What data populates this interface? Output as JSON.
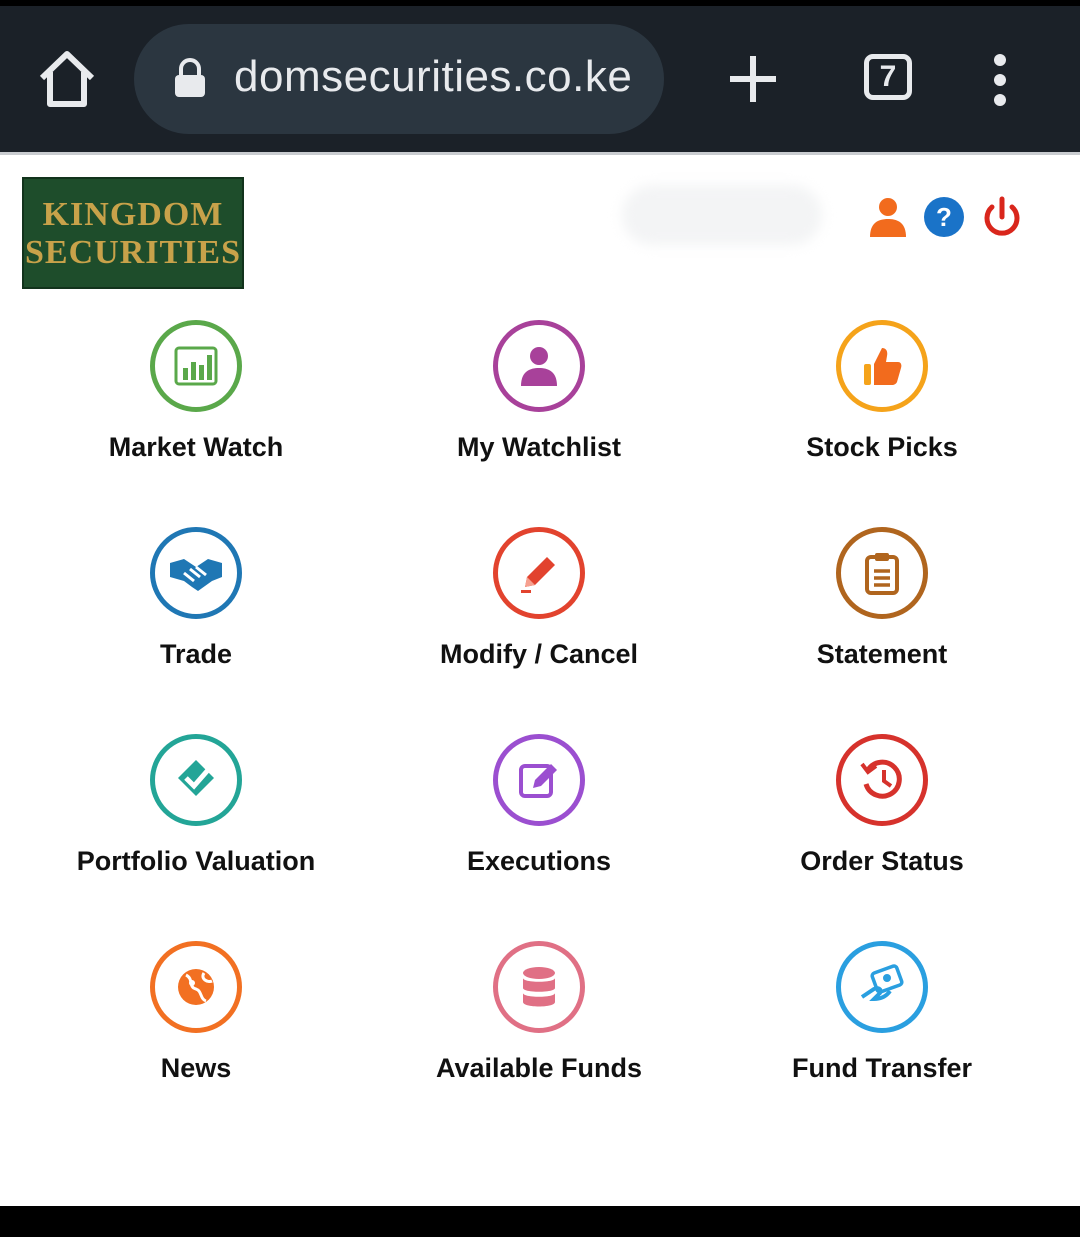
{
  "browser": {
    "url": "domsecurities.co.ke",
    "tab_count": "7"
  },
  "header": {
    "logo_line1": "KINGDOM",
    "logo_line2": "SECURITIES"
  },
  "menu": [
    {
      "label": "Market Watch",
      "icon": "bar-chart-icon",
      "color": "#5aa84a"
    },
    {
      "label": "My Watchlist",
      "icon": "person-icon",
      "color": "#a8419a"
    },
    {
      "label": "Stock Picks",
      "icon": "thumbs-up-icon",
      "color": "#f5a31a"
    },
    {
      "label": "Trade",
      "icon": "handshake-icon",
      "color": "#1f77b4"
    },
    {
      "label": "Modify / Cancel",
      "icon": "pencil-icon",
      "color": "#e2432e"
    },
    {
      "label": "Statement",
      "icon": "clipboard-icon",
      "color": "#b0651e"
    },
    {
      "label": "Portfolio Valuation",
      "icon": "check-shield-icon",
      "color": "#23a597"
    },
    {
      "label": "Executions",
      "icon": "edit-note-icon",
      "color": "#9b4fd0"
    },
    {
      "label": "Order Status",
      "icon": "history-icon",
      "color": "#d6322c"
    },
    {
      "label": "News",
      "icon": "globe-icon",
      "color": "#f27022"
    },
    {
      "label": "Available Funds",
      "icon": "database-icon",
      "color": "#e07085"
    },
    {
      "label": "Fund Transfer",
      "icon": "money-hand-icon",
      "color": "#2a9fe0"
    }
  ]
}
